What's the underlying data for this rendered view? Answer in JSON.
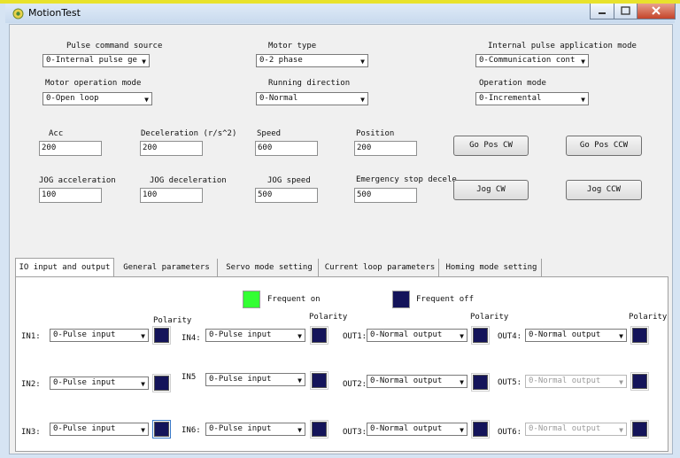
{
  "window": {
    "title": "MotionTest"
  },
  "colors": {
    "frequent_on": "#33ff33",
    "frequent_off": "#14145a"
  },
  "settings": {
    "pulse_command_source": {
      "label": "Pulse command source",
      "value": "0-Internal pulse ge"
    },
    "motor_type": {
      "label": "Motor type",
      "value": "0-2 phase"
    },
    "internal_pulse_mode": {
      "label": "Internal pulse application mode",
      "value": "0-Communication cont"
    },
    "motor_operation_mode": {
      "label": "Motor operation mode",
      "value": "0-Open loop"
    },
    "running_direction": {
      "label": "Running direction",
      "value": "0-Normal"
    },
    "operation_mode": {
      "label": "Operation mode",
      "value": "0-Incremental"
    }
  },
  "motion": {
    "acc": {
      "label": "Acc",
      "value": "200"
    },
    "deceleration": {
      "label": "Deceleration (r/s^2)",
      "value": "200"
    },
    "speed": {
      "label": "Speed",
      "value": "600"
    },
    "position": {
      "label": "Position",
      "value": "200"
    },
    "jog_acceleration": {
      "label": "JOG acceleration",
      "value": "100"
    },
    "jog_deceleration": {
      "label": "JOG deceleration",
      "value": "100"
    },
    "jog_speed": {
      "label": "JOG speed",
      "value": "500"
    },
    "emergency_stop": {
      "label": "Emergency stop decele",
      "value": "500"
    }
  },
  "buttons": {
    "go_pos_cw": "Go Pos CW",
    "go_pos_ccw": "Go Pos CCW",
    "jog_cw": "Jog CW",
    "jog_ccw": "Jog CCW"
  },
  "tabs": [
    "IO input and output",
    "General parameters",
    "Servo mode setting",
    "Current loop parameters",
    "Homing mode setting"
  ],
  "io": {
    "legend_on": "Frequent on",
    "legend_off": "Frequent off",
    "polarity": "Polarity",
    "inputs": [
      {
        "name": "IN1:",
        "value": "0-Pulse input"
      },
      {
        "name": "IN2:",
        "value": "0-Pulse input"
      },
      {
        "name": "IN3:",
        "value": "0-Pulse input"
      },
      {
        "name": "IN4:",
        "value": "0-Pulse input"
      },
      {
        "name": "IN5",
        "value": "0-Pulse input"
      },
      {
        "name": "IN6:",
        "value": "0-Pulse input"
      }
    ],
    "outputs": [
      {
        "name": "OUT1:",
        "value": "0-Normal output"
      },
      {
        "name": "OUT2:",
        "value": "0-Normal output"
      },
      {
        "name": "OUT3:",
        "value": "0-Normal output"
      },
      {
        "name": "OUT4:",
        "value": "0-Normal output"
      },
      {
        "name": "OUT5:",
        "value": "0-Normal output"
      },
      {
        "name": "OUT6:",
        "value": "0-Normal output"
      }
    ]
  }
}
